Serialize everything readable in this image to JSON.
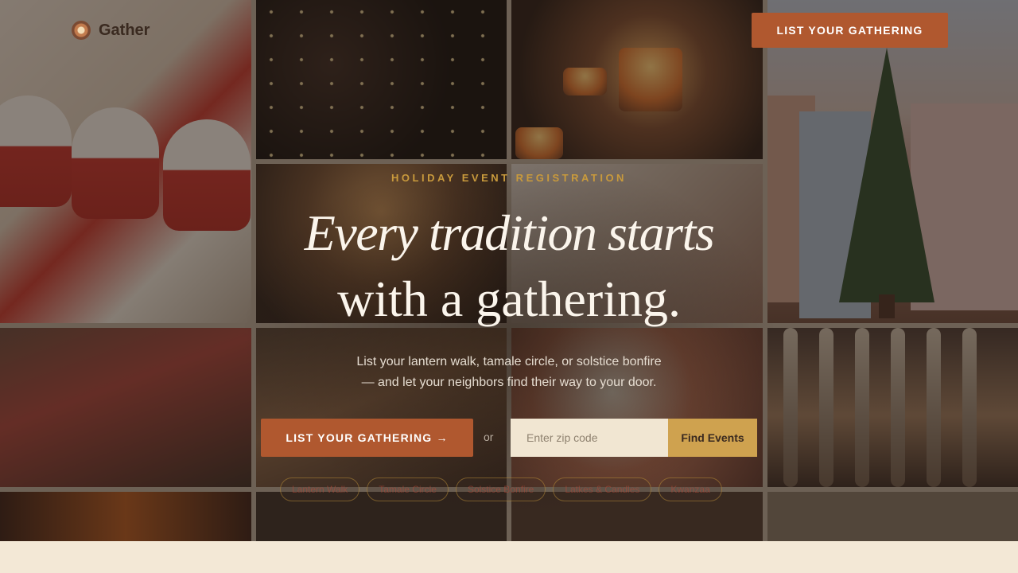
{
  "brand": {
    "name": "Gather",
    "icon": "wreath-icon"
  },
  "nav": {
    "cta_label": "LIST YOUR GATHERING"
  },
  "hero": {
    "eyebrow": "HOLIDAY EVENT REGISTRATION",
    "headline_line1": "Every tradition starts",
    "headline_line2": "with a gathering.",
    "subtitle_line1": "List your lantern walk, tamale circle, or solstice bonfire",
    "subtitle_line2": "— and let your neighbors find their way to your door.",
    "primary_cta": "LIST YOUR GATHERING →",
    "or_text": "or",
    "zip_placeholder": "Enter zip code",
    "find_button": "Find Events"
  },
  "chips": [
    "Lantern Walk",
    "Tamale Circle",
    "Solstice Bonfire",
    "Latkes & Candles",
    "Kwanzaa"
  ],
  "colors": {
    "accent": "#b0582f",
    "gold": "#cfa24f",
    "cream": "#f3e8d6"
  }
}
